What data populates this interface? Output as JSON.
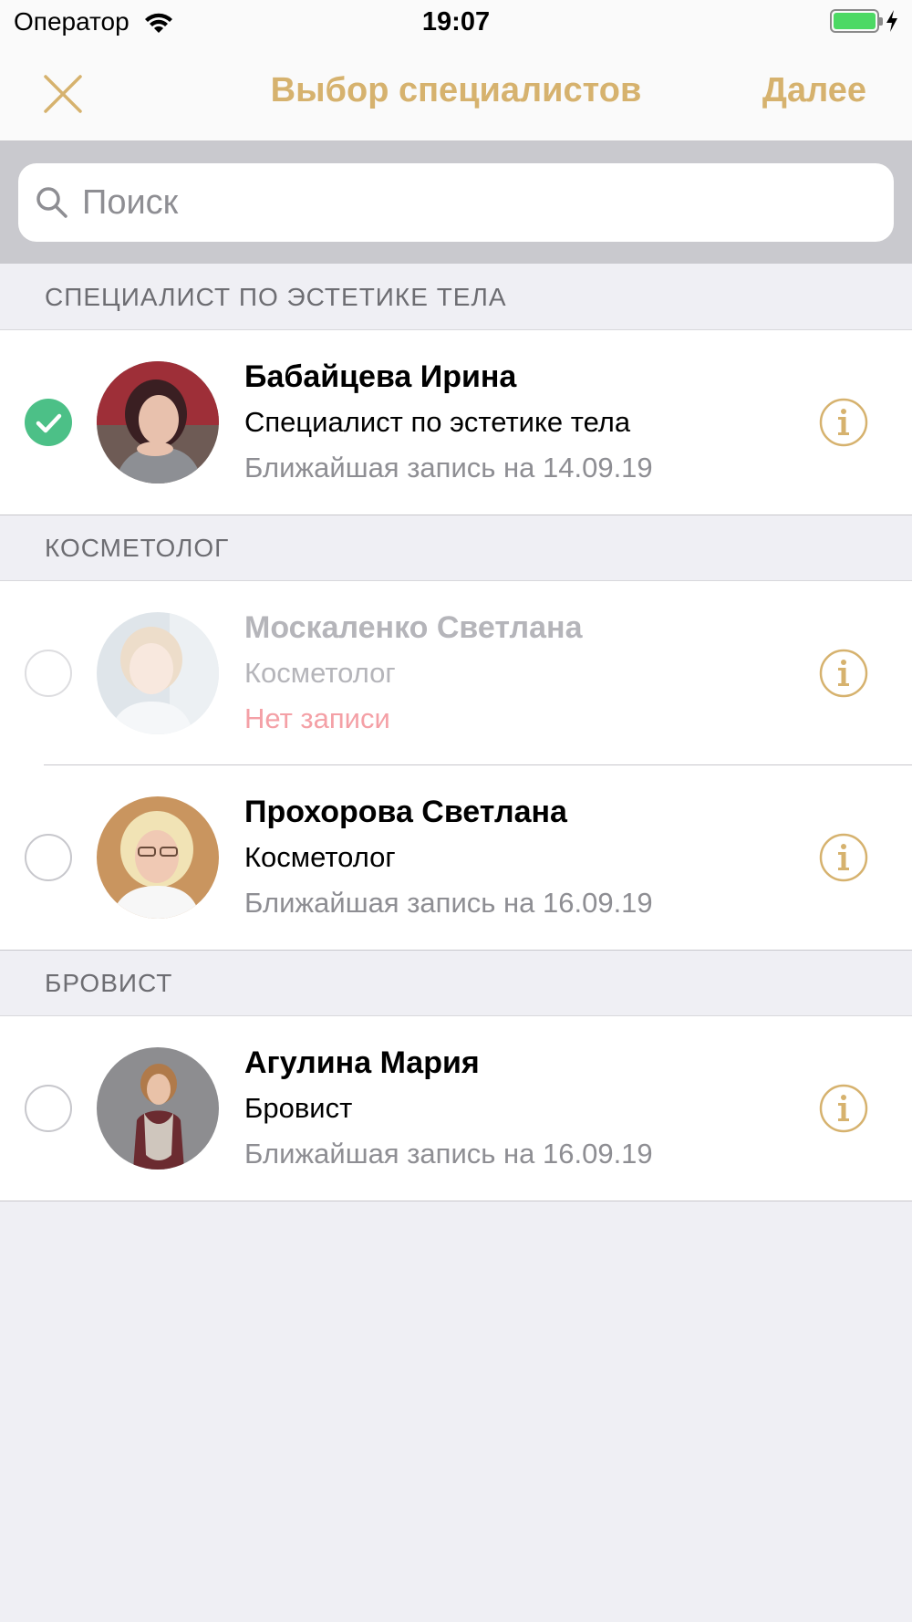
{
  "status_bar": {
    "carrier": "Оператор",
    "time": "19:07",
    "wifi_icon": "wifi-icon",
    "battery_icon": "battery-icon",
    "battery_level": 1.0,
    "charging_icon": "lightning-icon"
  },
  "nav": {
    "close_icon": "close-icon",
    "title": "Выбор специалистов",
    "next_label": "Далее"
  },
  "search": {
    "placeholder": "Поиск",
    "icon": "search-icon"
  },
  "sections": [
    {
      "title": "СПЕЦИАЛИСТ ПО ЭСТЕТИКЕ ТЕЛА",
      "items": [
        {
          "name": "Бабайцева Ирина",
          "role": "Специалист по эстетике тела",
          "nearest": "Ближайшая запись на 14.09.19",
          "selected": true,
          "available": true
        }
      ]
    },
    {
      "title": "КОСМЕТОЛОГ",
      "items": [
        {
          "name": "Москаленко Светлана",
          "role": "Косметолог",
          "nearest": "Нет записи",
          "selected": false,
          "available": false
        },
        {
          "name": "Прохорова Светлана",
          "role": "Косметолог",
          "nearest": "Ближайшая запись на 16.09.19",
          "selected": false,
          "available": true
        }
      ]
    },
    {
      "title": "БРОВИСТ",
      "items": [
        {
          "name": "Агулина Мария",
          "role": "Бровист",
          "nearest": "Ближайшая запись на 16.09.19",
          "selected": false,
          "available": true
        }
      ]
    }
  ],
  "colors": {
    "accent": "#d6b26e",
    "checked": "#4cc087",
    "no_slot": "#f4a0a6",
    "background": "#efeff4"
  }
}
